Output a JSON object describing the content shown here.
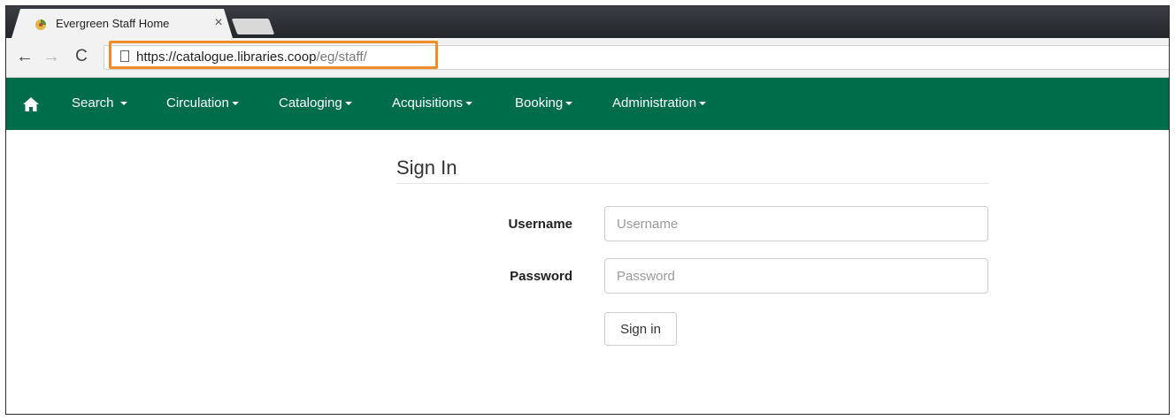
{
  "browser": {
    "tab_title": "Evergreen Staff Home",
    "tab_close": "×",
    "url_host": "https://catalogue.libraries.coop",
    "url_path": "/eg/staff/",
    "highlight_color": "#f28c28"
  },
  "navbar": {
    "brand_color": "#006d4a",
    "items": [
      {
        "label": "Search",
        "icon": "caret-down-icon"
      },
      {
        "label": "Circulation",
        "icon": "caret-down-icon"
      },
      {
        "label": "Cataloging",
        "icon": "caret-down-icon"
      },
      {
        "label": "Acquisitions",
        "icon": "caret-down-icon"
      },
      {
        "label": "Booking",
        "icon": "caret-down-icon"
      },
      {
        "label": "Administration",
        "icon": "caret-down-icon"
      }
    ]
  },
  "signin": {
    "title": "Sign In",
    "username_label": "Username",
    "username_placeholder": "Username",
    "password_label": "Password",
    "password_placeholder": "Password",
    "submit_label": "Sign in"
  }
}
